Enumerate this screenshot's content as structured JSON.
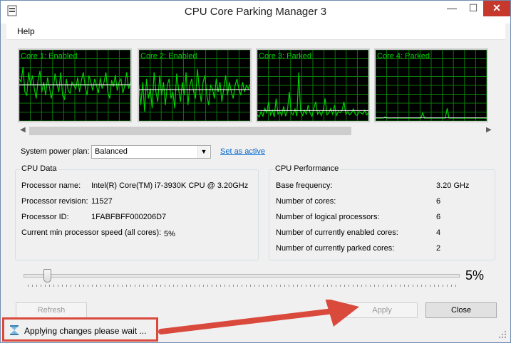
{
  "window": {
    "title": "CPU Core Parking Manager 3",
    "min_glyph": "—",
    "max_glyph": "☐",
    "close_glyph": "✕"
  },
  "menu": {
    "help": "Help"
  },
  "cores": [
    {
      "label": "Core 1: Enabled",
      "values": [
        60,
        55,
        78,
        40,
        35,
        70,
        50,
        65,
        45,
        30,
        58,
        72,
        40,
        55,
        35,
        62,
        48,
        30,
        44,
        68,
        52,
        40,
        70,
        35,
        28,
        60,
        42,
        38,
        55,
        50,
        45,
        62,
        40,
        58,
        70,
        48,
        35,
        65,
        55,
        42,
        60,
        50,
        38,
        62,
        45,
        55,
        70,
        40,
        30,
        58,
        48,
        66,
        42,
        55,
        60,
        38,
        50,
        70,
        45,
        55
      ]
    },
    {
      "label": "Core 2: Enabled",
      "values": [
        50,
        20,
        55,
        10,
        60,
        30,
        45,
        15,
        70,
        40,
        25,
        65,
        35,
        55,
        20,
        50,
        60,
        30,
        40,
        15,
        68,
        45,
        25,
        55,
        35,
        70,
        20,
        50,
        60,
        40,
        30,
        75,
        45,
        25,
        55,
        65,
        35,
        20,
        50,
        45,
        30,
        60,
        40,
        55,
        25,
        45,
        65,
        35,
        55,
        40,
        30,
        50,
        60,
        45,
        35,
        55,
        40,
        50,
        45,
        52
      ]
    },
    {
      "label": "Core 3: Parked",
      "values": [
        5,
        2,
        10,
        3,
        15,
        8,
        25,
        5,
        12,
        2,
        30,
        6,
        10,
        4,
        18,
        3,
        12,
        40,
        8,
        5,
        14,
        3,
        70,
        10,
        4,
        12,
        6,
        20,
        8,
        3,
        15,
        25,
        6,
        10,
        4,
        12,
        30,
        5,
        8,
        15,
        6,
        20,
        4,
        10,
        8,
        12,
        25,
        6,
        10,
        5,
        8,
        14,
        6,
        4,
        10,
        8,
        6,
        12,
        5,
        8
      ]
    },
    {
      "label": "Core 4: Parked",
      "values": [
        0,
        0,
        0,
        0,
        0,
        2,
        0,
        0,
        0,
        0,
        0,
        0,
        0,
        0,
        0,
        0,
        0,
        0,
        0,
        0,
        0,
        0,
        0,
        0,
        0,
        8,
        0,
        0,
        0,
        0,
        0,
        0,
        0,
        0,
        0,
        0,
        0,
        0,
        15,
        0,
        0,
        0,
        0,
        0,
        0,
        0,
        0,
        0,
        0,
        0,
        0,
        0,
        0,
        0,
        0,
        0,
        0,
        0,
        0,
        0
      ]
    }
  ],
  "power_plan": {
    "label": "System power plan:",
    "value": "Balanced",
    "set_active": "Set as active"
  },
  "cpu_data": {
    "title": "CPU Data",
    "rows": [
      {
        "label": "Processor name:",
        "value": "Intel(R) Core(TM) i7-3930K CPU @ 3.20GHz"
      },
      {
        "label": "Processor revision:",
        "value": "11527"
      },
      {
        "label": "Processor ID:",
        "value": "1FABFBFF000206D7"
      },
      {
        "label": "Current min processor speed (all cores):",
        "value": "5%"
      }
    ]
  },
  "cpu_perf": {
    "title": "CPU Performance",
    "rows": [
      {
        "label": "Base frequency:",
        "value": "3.20 GHz"
      },
      {
        "label": "Number of cores:",
        "value": "6"
      },
      {
        "label": "Number of logical processors:",
        "value": "6"
      },
      {
        "label": "Number of currently enabled cores:",
        "value": "4"
      },
      {
        "label": "Number of currently parked cores:",
        "value": "2"
      }
    ]
  },
  "slider": {
    "value_label": "5%",
    "value": 5
  },
  "buttons": {
    "refresh": "Refresh",
    "apply": "Apply",
    "close": "Close"
  },
  "status": {
    "text": "Applying changes please wait ..."
  },
  "colors": {
    "graph_green": "#00d000",
    "grid_green": "#0a7a0a",
    "annotation_red": "#d94a3d"
  }
}
